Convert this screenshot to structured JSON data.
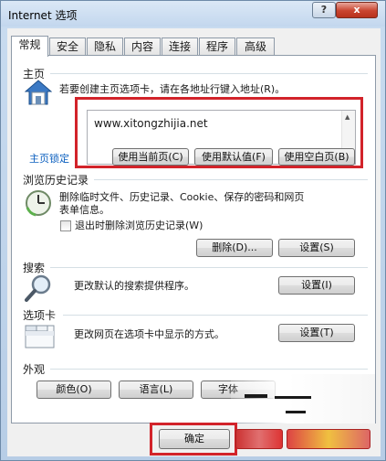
{
  "window": {
    "title": "Internet 选项",
    "help_label": "?",
    "close_label": "x"
  },
  "tabs": [
    "常规",
    "安全",
    "隐私",
    "内容",
    "连接",
    "程序",
    "高级"
  ],
  "home": {
    "header": "主页",
    "description": "若要创建主页选项卡，请在各地址行键入地址(R)。",
    "url": "www.xitongzhijia.net",
    "locked_label": "主页锁定",
    "btn_current": "使用当前页(C)",
    "btn_default": "使用默认值(F)",
    "btn_blank": "使用空白页(B)"
  },
  "history": {
    "header": "浏览历史记录",
    "description_line1": "删除临时文件、历史记录、Cookie、保存的密码和网页",
    "description_line2": "表单信息。",
    "checkbox_label": "退出时删除浏览历史记录(W)",
    "btn_delete": "删除(D)...",
    "btn_settings": "设置(S)"
  },
  "search": {
    "header": "搜索",
    "description": "更改默认的搜索提供程序。",
    "btn_settings": "设置(I)"
  },
  "tabs_section": {
    "header": "选项卡",
    "description": "更改网页在选项卡中显示的方式。",
    "btn_settings": "设置(T)"
  },
  "appearance": {
    "header": "外观",
    "btn_colors": "颜色(O)",
    "btn_languages": "语言(L)",
    "btn_fonts": "字体"
  },
  "footer": {
    "btn_ok": "确定"
  },
  "colors": {
    "highlight": "#d2232a",
    "link": "#0b5fbf"
  }
}
